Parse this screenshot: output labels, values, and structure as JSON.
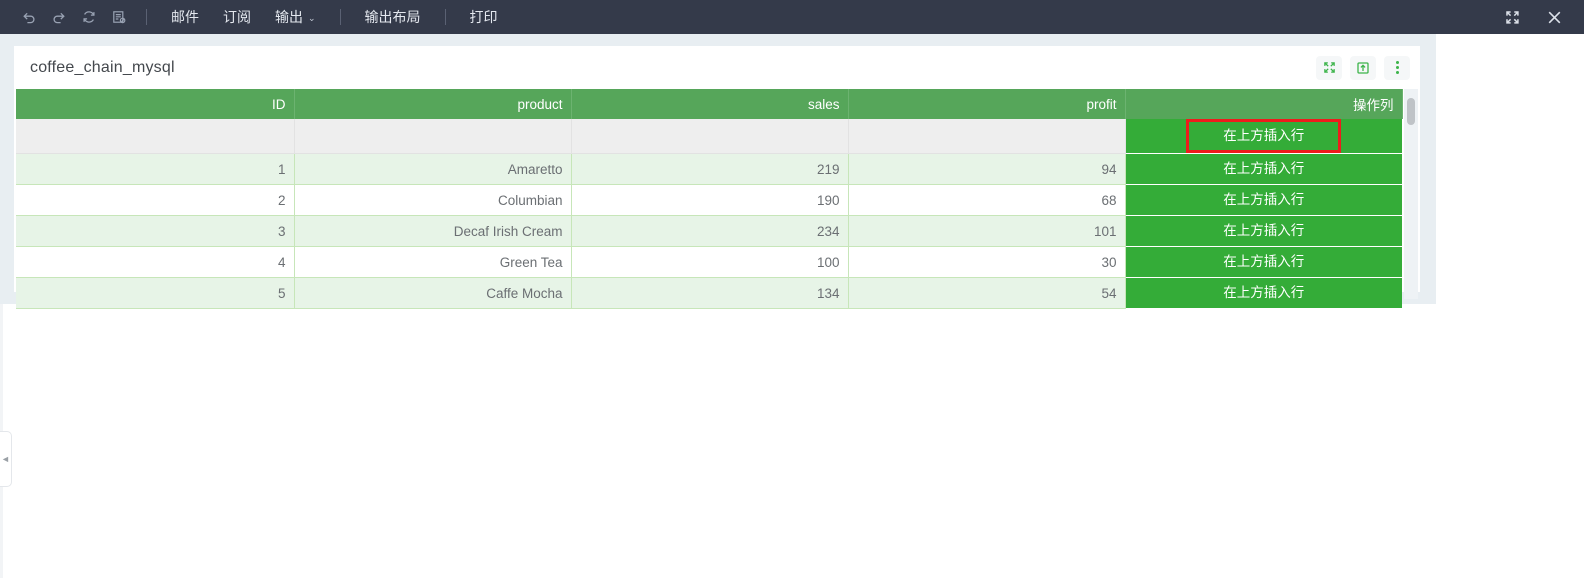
{
  "toolbar": {
    "icons": [
      {
        "name": "undo-icon",
        "label": "撤销"
      },
      {
        "name": "redo-icon",
        "label": "重做"
      },
      {
        "name": "refresh-icon",
        "label": "刷新"
      },
      {
        "name": "save-as-icon",
        "label": "另存"
      }
    ],
    "items": [
      {
        "name": "mail",
        "label": "邮件",
        "caret": false
      },
      {
        "name": "subscribe",
        "label": "订阅",
        "caret": false
      },
      {
        "name": "output",
        "label": "输出",
        "caret": true
      },
      {
        "name": "output-layout",
        "label": "输出布局",
        "caret": false
      },
      {
        "name": "print",
        "label": "打印",
        "caret": false
      }
    ],
    "caret_glyph": "⌄",
    "right": {
      "fullscreen_label": "全屏",
      "close_label": "关闭"
    }
  },
  "card": {
    "title": "coffee_chain_mysql",
    "tools": [
      {
        "name": "fullscreen-icon",
        "label": "全屏"
      },
      {
        "name": "export-icon",
        "label": "导出"
      },
      {
        "name": "more-menu-icon",
        "label": "更多"
      }
    ]
  },
  "table": {
    "columns": [
      {
        "key": "id",
        "label": "ID",
        "align": "right"
      },
      {
        "key": "product",
        "label": "product",
        "align": "left"
      },
      {
        "key": "sales",
        "label": "sales",
        "align": "right"
      },
      {
        "key": "profit",
        "label": "profit",
        "align": "right"
      },
      {
        "key": "action",
        "label": "操作列",
        "align": "center"
      }
    ],
    "insert_row_label": "在上方插入行",
    "blank_row": {
      "id": "",
      "product": "",
      "sales": "",
      "profit": ""
    },
    "rows": [
      {
        "id": "1",
        "product": "Amaretto",
        "sales": "219",
        "profit": "94",
        "action": "在上方插入行"
      },
      {
        "id": "2",
        "product": "Columbian",
        "sales": "190",
        "profit": "68",
        "action": "在上方插入行"
      },
      {
        "id": "3",
        "product": "Decaf Irish Cream",
        "sales": "234",
        "profit": "101",
        "action": "在上方插入行"
      },
      {
        "id": "4",
        "product": "Green Tea",
        "sales": "100",
        "profit": "30",
        "action": "在上方插入行"
      },
      {
        "id": "5",
        "product": "Caffe Mocha",
        "sales": "134",
        "profit": "54",
        "action": "在上方插入行"
      }
    ]
  },
  "sidebar": {
    "collapse_glyph": "◄"
  },
  "colors": {
    "toolbar_bg": "#343a4a",
    "header_green": "#56a65a",
    "action_green": "#34ac38",
    "highlight_red": "#ee1c1c",
    "canvas_bg": "#e8eef2"
  }
}
